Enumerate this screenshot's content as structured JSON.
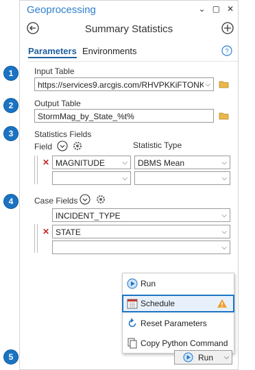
{
  "pane": {
    "title": "Geoprocessing",
    "window_controls": [
      "⌄",
      "▢",
      "✕"
    ]
  },
  "tool": {
    "title": "Summary Statistics"
  },
  "tabs": [
    {
      "label": "Parameters",
      "active": true
    },
    {
      "label": "Environments",
      "active": false
    }
  ],
  "params": {
    "input_table_label": "Input Table",
    "input_table_value": "https://services9.arcgis.com/RHVPKKiFTONK",
    "output_table_label": "Output Table",
    "output_table_value": "StormMag_by_State_%t%",
    "stats_fields_label": "Statistics Fields",
    "field_col_label": "Field",
    "stat_type_col_label": "Statistic Type",
    "stats_rows": [
      {
        "field": "MAGNITUDE",
        "stat": "DBMS Mean"
      },
      {
        "field": "",
        "stat": ""
      }
    ],
    "case_fields_label": "Case Fields",
    "case_rows": [
      "INCIDENT_TYPE",
      "STATE",
      ""
    ]
  },
  "menu": {
    "items": [
      "Run",
      "Schedule",
      "Reset Parameters",
      "Copy Python Command"
    ]
  },
  "run_button_label": "Run",
  "callouts": [
    "1",
    "2",
    "3",
    "4",
    "5"
  ],
  "colors": {
    "accent": "#1b73c2",
    "title_blue": "#2d7fcf",
    "remove_red": "#c62828",
    "warning": "#f0a030"
  }
}
